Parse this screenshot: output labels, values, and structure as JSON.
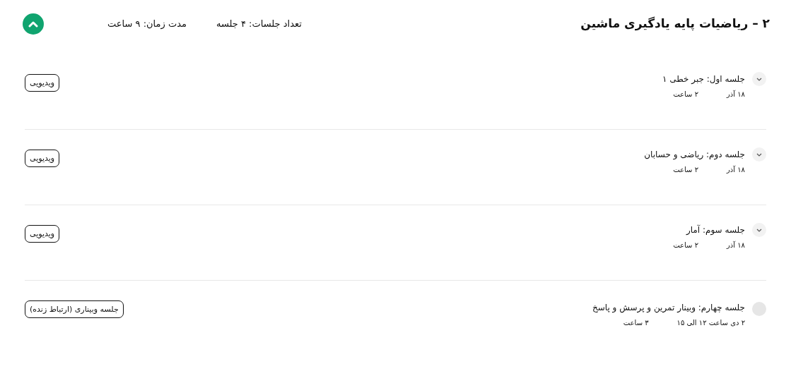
{
  "course": {
    "title": "۲ – ریاضیات پایه یادگیری ماشین",
    "sessions_count": "تعداد جلسات: ۴ جلسه",
    "duration": "مدت زمان: ۹ ساعت",
    "expanded": true
  },
  "sessions": [
    {
      "kind": "expandable",
      "title": "جلسه اول: جبر خطی ۱",
      "date": "۱۸ آذر",
      "duration": "۲ ساعت",
      "badge": "ویدیویی"
    },
    {
      "kind": "expandable",
      "title": "جلسه دوم: ریاضی و حسابان",
      "date": "۱۸ آذر",
      "duration": "۲ ساعت",
      "badge": "ویدیویی"
    },
    {
      "kind": "expandable",
      "title": "جلسه سوم: آمار",
      "date": "۱۸ آذر",
      "duration": "۲ ساعت",
      "badge": "ویدیویی"
    },
    {
      "kind": "plain",
      "title": "جلسه چهارم: وبینار تمرین و پرسش و پاسخ",
      "date": "۲ دی ساعت ۱۲ الی ۱۵",
      "duration": "۳ ساعت",
      "badge": "جلسه وبیناری (ارتباط زنده)"
    }
  ]
}
